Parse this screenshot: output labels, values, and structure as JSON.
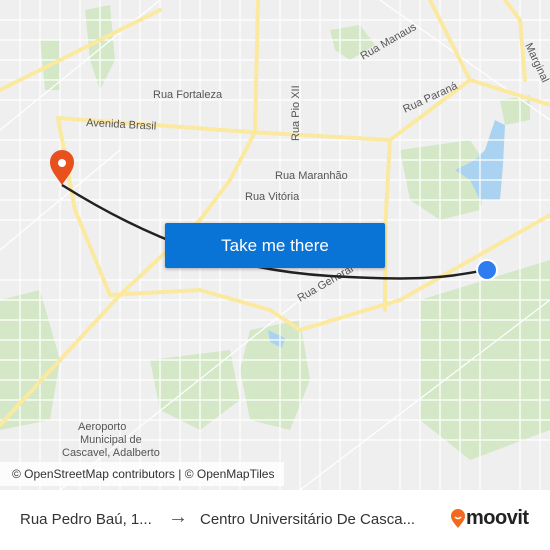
{
  "map": {
    "street_labels": [
      "Rua Manaus",
      "Rua Fortaleza",
      "Avenida Brasil",
      "Rua Pio XII",
      "Rua Paraná",
      "Rua Maranhão",
      "Rua Vitória",
      "Rua General",
      "Marginal"
    ],
    "poi_labels": [
      "Aeroporto",
      "Municipal de",
      "Cascavel, Adalberto"
    ],
    "attribution": "© OpenStreetMap contributors | © OpenMapTiles",
    "destination_pin_color": "#e8501e",
    "origin_dot_color": "#2f7bf0",
    "route_color": "#222222"
  },
  "cta": {
    "label": "Take me there",
    "color": "#0a73d6"
  },
  "footer": {
    "from": "Rua Pedro Baú, 1...",
    "arrow": "→",
    "to": "Centro Universitário De Cascа...",
    "brand": "moovit",
    "brand_color": "#f26a21"
  }
}
